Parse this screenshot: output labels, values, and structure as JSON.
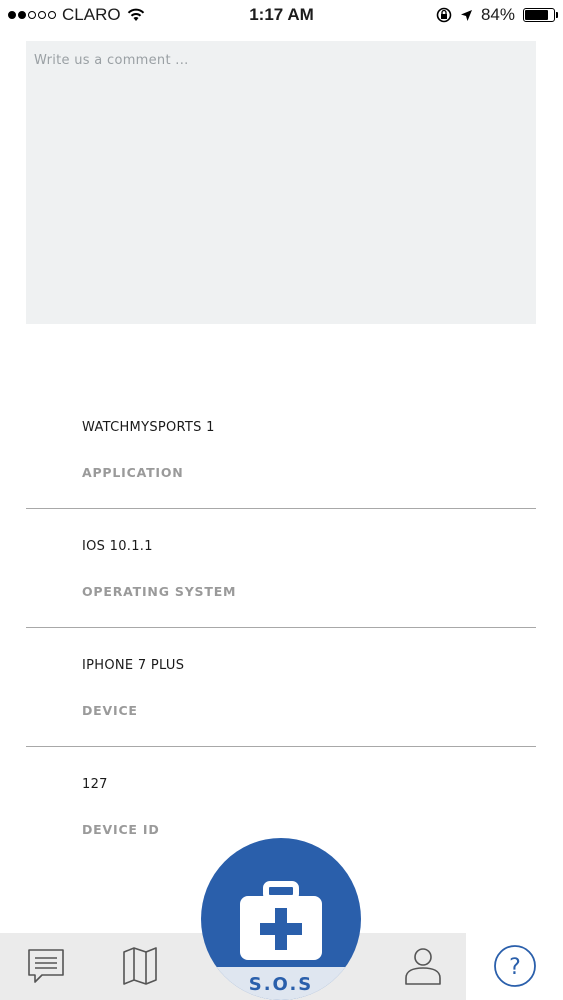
{
  "status_bar": {
    "carrier": "CLARO",
    "signal_bars_filled": 2,
    "signal_bars_total": 5,
    "time": "1:17 AM",
    "battery_percent": "84%",
    "battery_level": 0.84,
    "icons": [
      "wifi-icon",
      "orientation-lock-icon",
      "location-arrow-icon",
      "battery-icon"
    ]
  },
  "comment": {
    "placeholder": "Write us a comment ...",
    "value": ""
  },
  "info": [
    {
      "value": "WATCHMYSPORTS 1",
      "label": "APPLICATION"
    },
    {
      "value": "IOS 10.1.1",
      "label": "OPERATING SYSTEM"
    },
    {
      "value": "IPHONE 7 PLUS",
      "label": "DEVICE"
    },
    {
      "value": "127",
      "label": "DEVICE ID"
    }
  ],
  "tab_bar": {
    "tabs": [
      {
        "icon": "message-icon"
      },
      {
        "icon": "map-icon"
      },
      {
        "icon": "profile-icon"
      },
      {
        "icon": "help-icon",
        "active": true
      }
    ],
    "sos_label": "S.O.S",
    "sos_icon": "first-aid-kit-icon",
    "accent_color": "#2a5fab"
  }
}
